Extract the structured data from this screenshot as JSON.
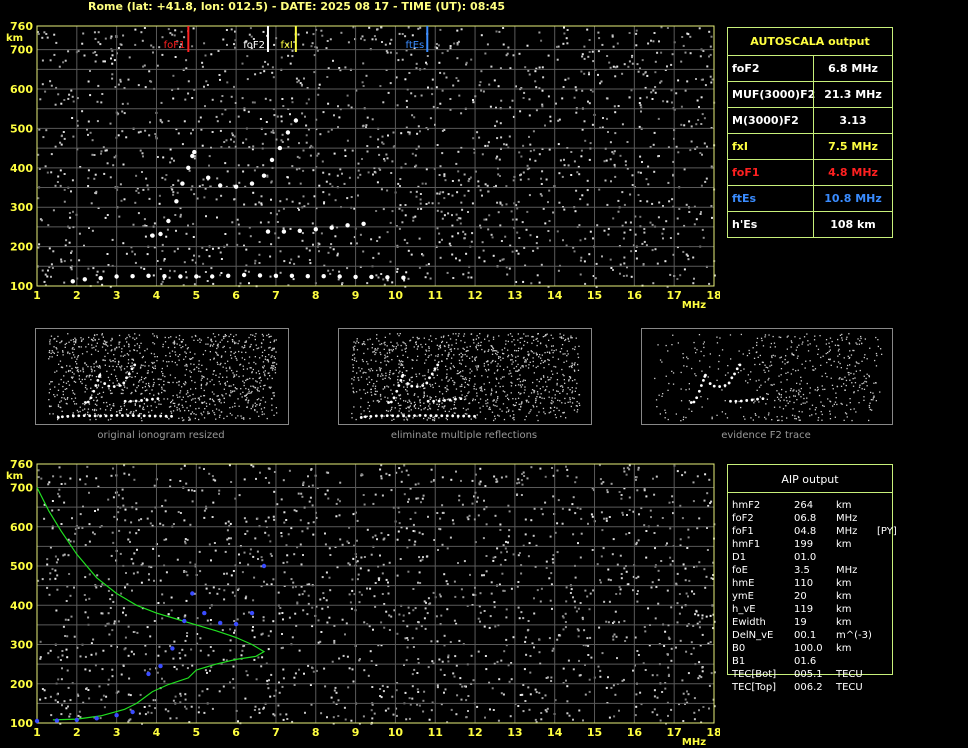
{
  "header": "Rome (lat: +41.8, lon: 012.5) - DATE: 2025 08 17 - TIME (UT): 08:45",
  "axes": {
    "y_unit": "km",
    "x_unit": "MHz",
    "x_ticks": [
      "1",
      "2",
      "3",
      "4",
      "5",
      "6",
      "7",
      "8",
      "9",
      "10",
      "11",
      "12",
      "13",
      "14",
      "15",
      "16",
      "17",
      "18"
    ],
    "y_ticks": [
      "760",
      "700",
      "600",
      "500",
      "400",
      "300",
      "200",
      "100"
    ],
    "xlim": [
      1,
      18
    ],
    "ylim": [
      100,
      760
    ]
  },
  "markers": [
    {
      "label": "foF1",
      "freq": 4.8,
      "color": "#ff2020"
    },
    {
      "label": "foF2",
      "freq": 6.8,
      "color": "#ffffff"
    },
    {
      "label": "fxI",
      "freq": 7.5,
      "color": "#ffff40"
    },
    {
      "label": "ftEs",
      "freq": 10.8,
      "color": "#3a8cff"
    }
  ],
  "autoscala": {
    "title": "AUTOSCALA output",
    "rows": [
      {
        "label": "foF2",
        "value": "6.8 MHz",
        "color": "#ffffff"
      },
      {
        "label": "MUF(3000)F2",
        "value": "21.3 MHz",
        "color": "#ffffff"
      },
      {
        "label": "M(3000)F2",
        "value": "3.13",
        "color": "#ffffff"
      },
      {
        "label": "fxI",
        "value": "7.5 MHz",
        "color": "#ffff40"
      },
      {
        "label": "foF1",
        "value": "4.8 MHz",
        "color": "#ff2020"
      },
      {
        "label": "ftEs",
        "value": "10.8 MHz",
        "color": "#3a8cff"
      },
      {
        "label": "h'Es",
        "value": "108    km",
        "color": "#ffffff"
      }
    ]
  },
  "thumbnails": [
    {
      "caption": "original ionogram resized"
    },
    {
      "caption": "eliminate multiple reflections"
    },
    {
      "caption": "evidence F2 trace"
    }
  ],
  "aip": {
    "title": "AIP output",
    "rows": [
      {
        "name": "hmF2",
        "value": "264",
        "unit": "km",
        "flag": ""
      },
      {
        "name": "foF2",
        "value": "06.8",
        "unit": "MHz",
        "flag": ""
      },
      {
        "name": "foF1",
        "value": "04.8",
        "unit": "MHz",
        "flag": "[PY]"
      },
      {
        "name": "hmF1",
        "value": "199",
        "unit": "km",
        "flag": ""
      },
      {
        "name": "D1",
        "value": "01.0",
        "unit": "",
        "flag": ""
      },
      {
        "name": "foE",
        "value": "3.5",
        "unit": "MHz",
        "flag": ""
      },
      {
        "name": "hmE",
        "value": "110",
        "unit": "km",
        "flag": ""
      },
      {
        "name": "ymE",
        "value": "20",
        "unit": "km",
        "flag": ""
      },
      {
        "name": "h_vE",
        "value": "119",
        "unit": "km",
        "flag": ""
      },
      {
        "name": "Ewidth",
        "value": "19",
        "unit": "km",
        "flag": ""
      },
      {
        "name": "DelN_vE",
        "value": "00.1",
        "unit": "m^(-3)",
        "flag": ""
      },
      {
        "name": "B0",
        "value": "100.0",
        "unit": "km",
        "flag": ""
      },
      {
        "name": "B1",
        "value": "01.6",
        "unit": "",
        "flag": ""
      },
      {
        "name": "TEC[Bot]",
        "value": "005.1",
        "unit": "TECU",
        "flag": ""
      },
      {
        "name": "TEC[Top]",
        "value": "006.2",
        "unit": "TECU",
        "flag": ""
      }
    ]
  },
  "chart_data": [
    {
      "type": "scatter",
      "title": "",
      "xlabel": "MHz",
      "ylabel": "km",
      "xlim": [
        1,
        18
      ],
      "ylim": [
        100,
        760
      ],
      "grid": true,
      "series": [
        {
          "color": "#ffffff",
          "x": [
            1.9,
            2.2,
            2.6,
            3.0,
            3.4,
            3.8,
            4.2,
            4.6,
            5.0,
            5.4,
            5.8,
            6.2,
            6.6,
            7.0,
            7.4,
            7.8,
            8.2,
            8.6,
            9.0,
            9.4,
            9.8,
            10.2
          ],
          "y": [
            112,
            117,
            120,
            124,
            125,
            126,
            125,
            124,
            124,
            124,
            126,
            128,
            127,
            126,
            126,
            125,
            125,
            124,
            123,
            123,
            122,
            121
          ]
        },
        {
          "color": "#ffffff",
          "x": [
            3.9,
            4.1,
            4.3,
            4.5,
            4.65,
            4.8,
            4.9,
            4.95,
            5.3,
            5.6,
            6.0,
            6.4,
            6.7,
            6.9,
            7.1,
            7.3,
            7.5
          ],
          "y": [
            228,
            232,
            265,
            315,
            360,
            400,
            430,
            440,
            375,
            355,
            352,
            360,
            380,
            420,
            450,
            490,
            520
          ]
        },
        {
          "color": "#ffffff",
          "x": [
            6.8,
            7.2,
            7.6,
            8.0,
            8.4,
            8.8,
            9.2
          ],
          "y": [
            238,
            238,
            240,
            244,
            248,
            254,
            258
          ]
        }
      ]
    },
    {
      "type": "line",
      "title": "",
      "xlabel": "MHz",
      "ylabel": "km",
      "xlim": [
        1,
        18
      ],
      "ylim": [
        100,
        760
      ],
      "grid": true,
      "series": [
        {
          "color": "#20e020",
          "x": [
            1.0,
            1.3,
            1.6,
            2.0,
            2.5,
            3.0,
            3.5,
            4.0,
            4.5,
            5.0,
            5.5,
            6.0,
            6.4,
            6.7,
            6.5,
            6.0,
            5.5,
            5.0,
            4.8,
            4.3,
            3.9,
            3.5,
            3.2,
            2.6,
            2.0,
            1.4
          ],
          "y": [
            700,
            640,
            590,
            530,
            470,
            430,
            400,
            380,
            365,
            350,
            335,
            318,
            300,
            282,
            270,
            262,
            250,
            235,
            215,
            198,
            180,
            150,
            135,
            118,
            110,
            108
          ]
        },
        {
          "color": "#3a4cff",
          "x": [
            1.0,
            1.5,
            2.0,
            2.5,
            3.0,
            3.4,
            3.8,
            4.1,
            4.4,
            4.7,
            4.9,
            5.2,
            5.6,
            6.0,
            6.4,
            6.7
          ],
          "y": [
            105,
            106,
            108,
            112,
            120,
            128,
            225,
            245,
            290,
            360,
            430,
            380,
            355,
            352,
            380,
            500
          ]
        }
      ]
    }
  ]
}
